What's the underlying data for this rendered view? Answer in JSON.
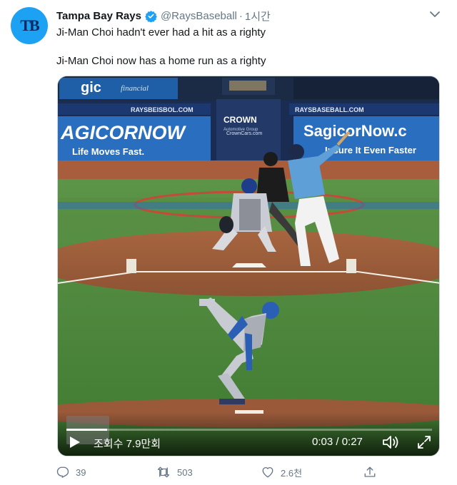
{
  "tweet": {
    "avatar_text": "TB",
    "display_name": "Tampa Bay Rays",
    "handle": "@RaysBaseball",
    "separator": "·",
    "time": "1시간",
    "text_line_1": "Ji-Man Choi hadn't ever had a hit as a righty",
    "text_line_2": "Ji-Man Choi now has a home run as a righty"
  },
  "video": {
    "views": "조회수 7.9만회",
    "time_display": "0:03 / 0:27",
    "progress_fraction": 0.111,
    "ads": {
      "left_banner": "AGICORNOW",
      "left_sub": "Life Moves Fast.",
      "left_url": "RAYSBEISBOL.COM",
      "crown_top": "CROWN",
      "crown_mid": "Automotive Group",
      "crown_url": "CrownCars.com",
      "right_banner": "SagicorNow.c",
      "right_sub": "Insure It Even Faster",
      "right_url": "RAYSBASEBALL.COM",
      "top_left": "gic",
      "top_left_sub": "financial"
    }
  },
  "actions": {
    "reply_count": "39",
    "retweet_count": "503",
    "like_count": "2.6천"
  },
  "colors": {
    "brand_blue": "#1da1f2",
    "muted": "#657786",
    "field_green": "#4e8a3e",
    "dirt": "#9a5a3a"
  }
}
